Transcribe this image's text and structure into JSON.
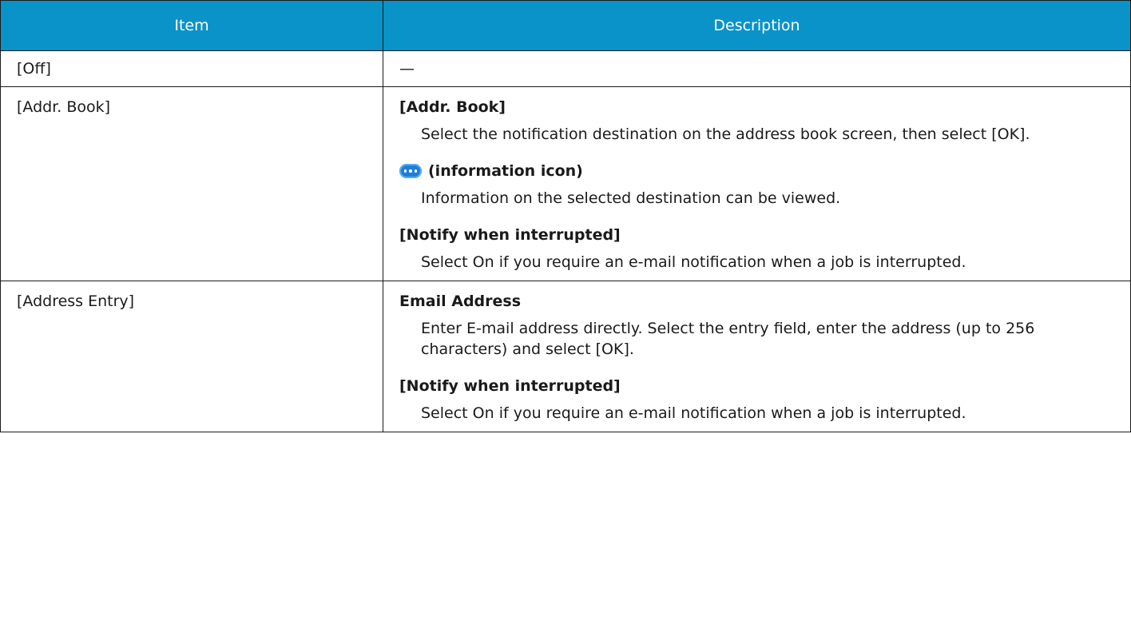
{
  "table": {
    "headers": {
      "item": "Item",
      "description": "Description"
    },
    "rows": [
      {
        "item": "[Off]",
        "description_text": "—"
      },
      {
        "item": "[Addr. Book]",
        "entries": [
          {
            "title": "[Addr. Book]",
            "text": "Select the notification destination on the address book screen, then select [OK]."
          },
          {
            "title": "(information icon)",
            "icon": "information-icon",
            "text": "Information on the selected destination can be viewed."
          },
          {
            "title": "[Notify when interrupted]",
            "text": "Select On if you require an e-mail notification when a job is interrupted."
          }
        ]
      },
      {
        "item": "[Address Entry]",
        "entries": [
          {
            "title": "Email Address",
            "text": "Enter E-mail address directly. Select the entry field, enter the address (up to 256 characters) and select [OK]."
          },
          {
            "title": "[Notify when interrupted]",
            "text": "Select On if you require an e-mail notification when a job is interrupted."
          }
        ]
      }
    ]
  },
  "colors": {
    "header_background": "#0a93c8",
    "header_text": "#ffffff",
    "border": "#1a1a1a",
    "icon_blue": "#1f7fd6"
  }
}
